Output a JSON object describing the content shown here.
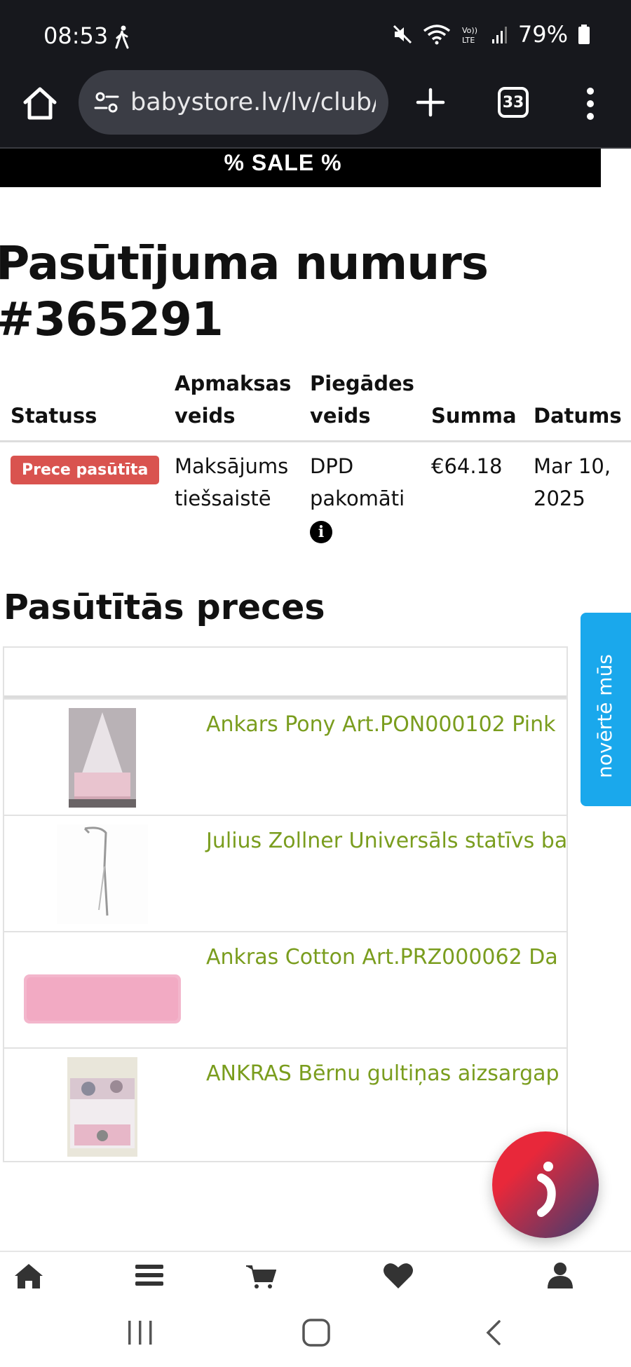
{
  "status_bar": {
    "time": "08:53",
    "battery": "79%",
    "icons": [
      "walking-icon",
      "mute-icon",
      "wifi-icon",
      "volte-icon",
      "signal-icon",
      "battery-icon"
    ]
  },
  "browser": {
    "url": "babystore.lv/lv/club/c",
    "tab_count": "33"
  },
  "banner": {
    "text": "% SALE %"
  },
  "order": {
    "title": "Pasūtījuma numurs #365291",
    "headers": {
      "status": "Statuss",
      "payment_1": "Apmaksas",
      "payment_2": "veids",
      "delivery_1": "Piegādes",
      "delivery_2": "veids",
      "sum": "Summa",
      "date": "Datums"
    },
    "row": {
      "status": "Prece pasūtīta",
      "payment_1": "Maksājums",
      "payment_2": "tiešsaistē",
      "delivery_1": "DPD",
      "delivery_2": "pakomāti",
      "sum": "€64.18",
      "date_1": "Mar 10,",
      "date_2": "2025"
    }
  },
  "products": {
    "title": "Pasūtītās preces",
    "items": [
      {
        "name": "Ankars Pony Art.PON000102 Pink"
      },
      {
        "name": "Julius Zollner Universāls statīvs ba"
      },
      {
        "name": "Ankras Cotton Art.PRZ000062 Da"
      },
      {
        "name": "ANKRAS Bērnu gultiņas aizsargap"
      }
    ]
  },
  "rate_tab": {
    "label": "novērtē mūs"
  },
  "colors": {
    "product_link": "#7a9d1e",
    "badge": "#d9534f",
    "rate_tab": "#1aa8ec",
    "banner_bg": "#000000",
    "chrome_bg": "#17181d"
  }
}
